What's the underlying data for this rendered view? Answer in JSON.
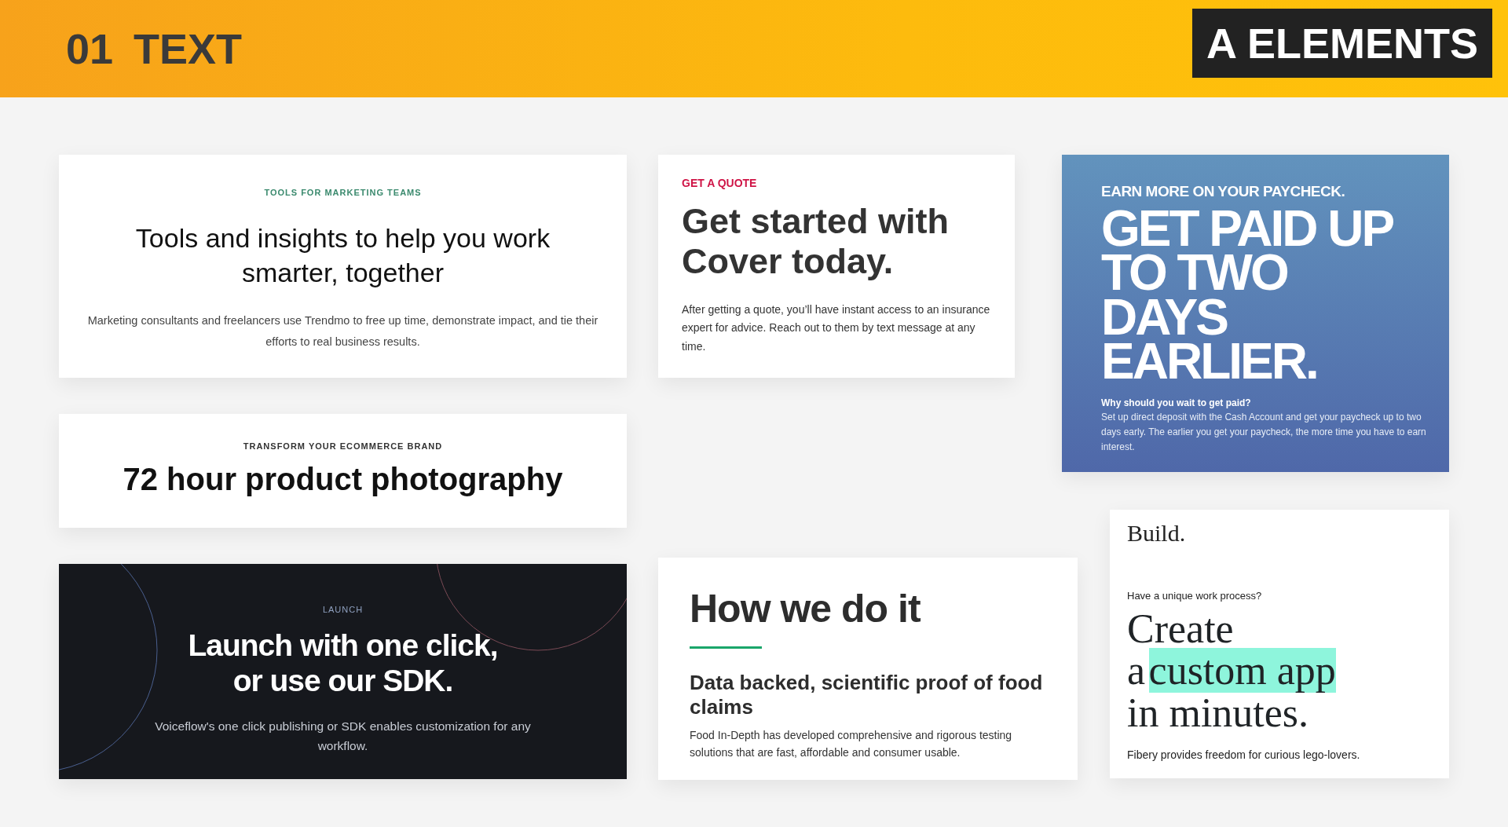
{
  "header": {
    "number": "01",
    "title": "TEXT",
    "badge": "A ELEMENTS"
  },
  "columns": [
    {
      "cards": [
        {
          "kind": "centered",
          "eyebrow": "TOOLS FOR MARKETING TEAMS",
          "headline": "Tools and insights to help you work smarter, together",
          "body": "Marketing consultants and freelancers use Trendmo to free up time, demonstrate impact, and tie their efforts to real business results."
        },
        {
          "kind": "photography",
          "eyebrow": "TRANSFORM YOUR ECOMMERCE BRAND",
          "headline": "72 hour product photography"
        },
        {
          "kind": "launch",
          "eyebrow": "LAUNCH",
          "headline": "Launch with one click, or use our SDK.",
          "body": "Voiceflow's one click publishing or SDK enables customization for any workflow."
        }
      ]
    },
    {
      "cards": [
        {
          "kind": "quote",
          "eyebrow": "GET A QUOTE",
          "headline": "Get started with Cover today.",
          "body": "After getting a quote, you’ll have instant access to an insurance expert for advice. Reach out to them by text message at any time."
        },
        {
          "kind": "how",
          "headline": "How we do it",
          "subheadline": "Data backed, scientific proof of food claims",
          "body": "Food In-Depth has developed comprehensive and rigorous testing solutions that are fast, affordable and consumer usable."
        }
      ]
    },
    {
      "cards": [
        {
          "kind": "paycheck",
          "eyebrow": "EARN MORE ON YOUR PAYCHECK.",
          "headline_lines": [
            "GET PAID UP",
            "TO TWO",
            "DAYS",
            "EARLIER."
          ],
          "question": "Why should you wait to get paid?",
          "body": "Set up direct deposit with the Cash Account and get your paycheck up to two days early. The earlier you get your paycheck, the more time you have to earn interest."
        },
        {
          "kind": "build",
          "eyebrow": "Build.",
          "question": "Have a unique work process?",
          "headline_lines": [
            [
              {
                "text": "Create",
                "highlighted": false
              }
            ],
            [
              {
                "text": "a",
                "highlighted": false
              },
              {
                "text": "custom app",
                "highlighted": true
              }
            ],
            [
              {
                "text": "in minutes.",
                "highlighted": false
              }
            ]
          ],
          "body": "Fibery provides freedom for curious lego-lovers."
        }
      ]
    }
  ]
}
